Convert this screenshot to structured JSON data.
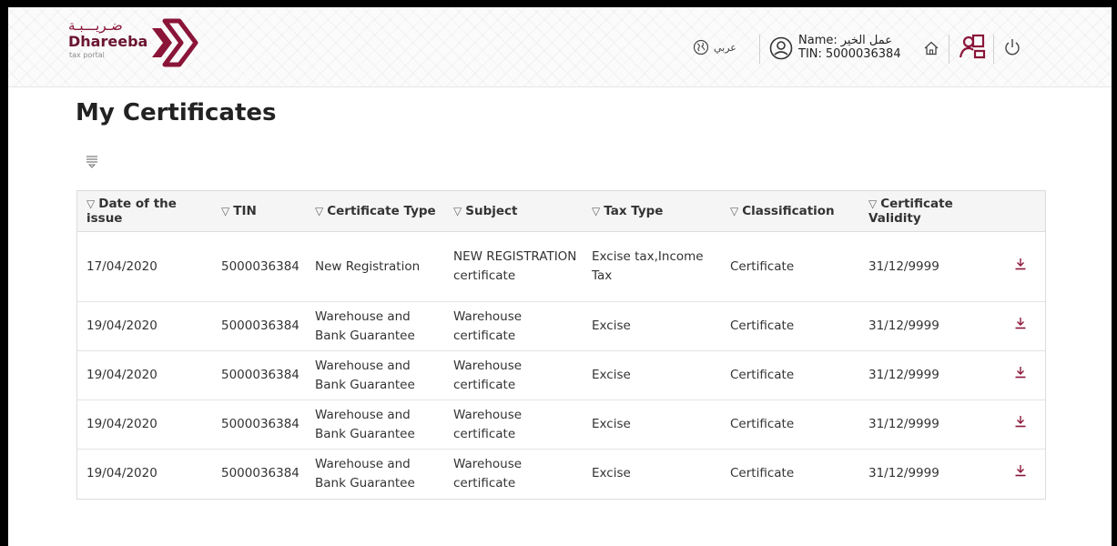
{
  "header": {
    "logo": {
      "arabic_text": "ضـريـــبـة",
      "english_text": "Dhareeba",
      "sub_text": "tax portal",
      "brand_color": "#8a1538"
    },
    "language_label": "عربي",
    "user": {
      "name_label": "Name:",
      "name_value": "عمل الخير",
      "tin_label": "TIN:",
      "tin_value": "5000036384"
    }
  },
  "page": {
    "title": "My Certificates"
  },
  "table": {
    "columns": [
      "Date of the issue",
      "TIN",
      "Certificate Type",
      "Subject",
      "Tax Type",
      "Classification",
      "Certificate Validity"
    ],
    "rows": [
      {
        "date": "17/04/2020",
        "tin": "5000036384",
        "certificate_type": "New Registration",
        "subject": "NEW REGISTRATION certificate",
        "tax_type": "Excise tax,Income Tax",
        "classification": "Certificate",
        "validity": "31/12/9999"
      },
      {
        "date": "19/04/2020",
        "tin": "5000036384",
        "certificate_type": "Warehouse and Bank Guarantee",
        "subject": "Warehouse certificate",
        "tax_type": "Excise",
        "classification": "Certificate",
        "validity": "31/12/9999"
      },
      {
        "date": "19/04/2020",
        "tin": "5000036384",
        "certificate_type": "Warehouse and Bank Guarantee",
        "subject": "Warehouse certificate",
        "tax_type": "Excise",
        "classification": "Certificate",
        "validity": "31/12/9999"
      },
      {
        "date": "19/04/2020",
        "tin": "5000036384",
        "certificate_type": "Warehouse and Bank Guarantee",
        "subject": "Warehouse certificate",
        "tax_type": "Excise",
        "classification": "Certificate",
        "validity": "31/12/9999"
      },
      {
        "date": "19/04/2020",
        "tin": "5000036384",
        "certificate_type": "Warehouse and Bank Guarantee",
        "subject": "Warehouse certificate",
        "tax_type": "Excise",
        "classification": "Certificate",
        "validity": "31/12/9999"
      }
    ]
  },
  "icons": {
    "language": "globe-icon",
    "user": "user-circle-icon",
    "home": "home-icon",
    "certificates": "certificates-icon",
    "logout": "power-icon",
    "filter": "filter-icon",
    "download": "download-icon",
    "accent_color": "#8a1538"
  }
}
